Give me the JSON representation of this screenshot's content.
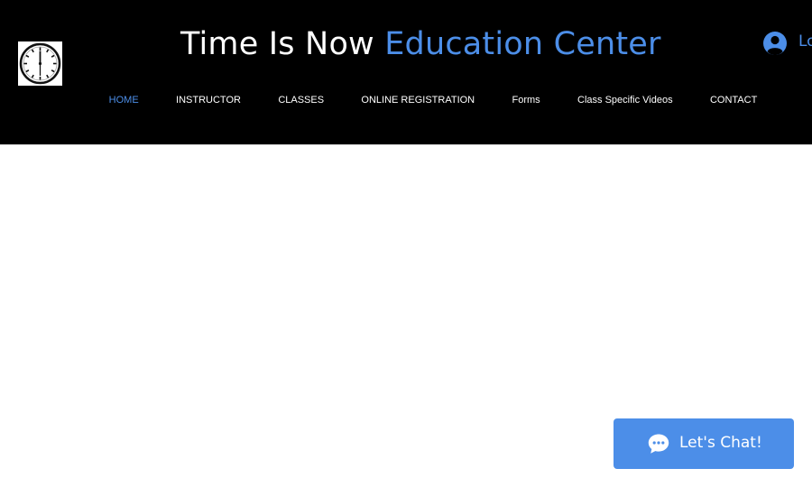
{
  "header": {
    "title_part1": "Time Is Now",
    "title_part2": "Education Center",
    "logo_icon": "clock-icon",
    "login_label": "Log In",
    "login_icon": "user-avatar-icon"
  },
  "nav": {
    "items": [
      {
        "label": "HOME",
        "active": true
      },
      {
        "label": "INSTRUCTOR"
      },
      {
        "label": "CLASSES"
      },
      {
        "label": "ONLINE REGISTRATION"
      },
      {
        "label": "Forms"
      },
      {
        "label": "Class Specific Videos"
      },
      {
        "label": "CONTACT"
      }
    ]
  },
  "chat": {
    "label": "Let's Chat!",
    "icon": "chat-bubble-icon"
  },
  "colors": {
    "header_bg": "#000000",
    "accent": "#4c8ee8",
    "page_bg": "#ffffff"
  }
}
